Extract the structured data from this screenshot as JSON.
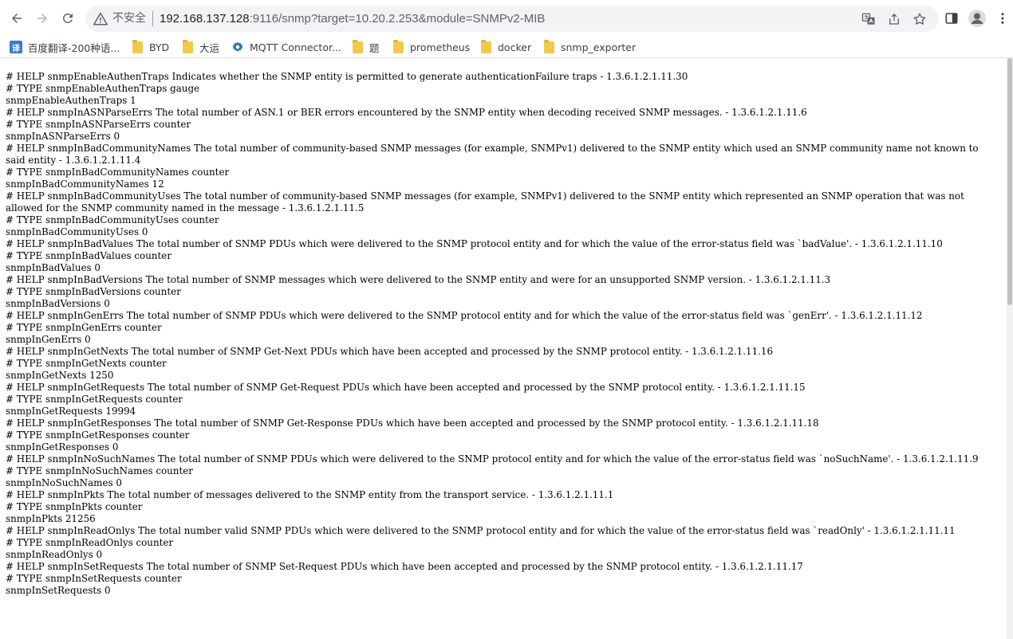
{
  "browser": {
    "insecure_label": "不安全",
    "url_host": "192.168.137.128",
    "url_rest": ":9116/snmp?target=10.20.2.253&module=SNMPv2-MIB"
  },
  "bookmarks": [
    {
      "label": "百度翻译-200种语...",
      "icon": "translate-icon",
      "badge": "译"
    },
    {
      "label": "BYD",
      "icon": "folder-icon"
    },
    {
      "label": "大运",
      "icon": "folder-icon"
    },
    {
      "label": "MQTT Connector...",
      "icon": "gear-icon"
    },
    {
      "label": "题",
      "icon": "folder-icon"
    },
    {
      "label": "prometheus",
      "icon": "folder-icon"
    },
    {
      "label": "docker",
      "icon": "folder-icon"
    },
    {
      "label": "snmp_exporter",
      "icon": "folder-icon"
    }
  ],
  "page_text": "# HELP snmpEnableAuthenTraps Indicates whether the SNMP entity is permitted to generate authenticationFailure traps - 1.3.6.1.2.1.11.30\n# TYPE snmpEnableAuthenTraps gauge\nsnmpEnableAuthenTraps 1\n# HELP snmpInASNParseErrs The total number of ASN.1 or BER errors encountered by the SNMP entity when decoding received SNMP messages. - 1.3.6.1.2.1.11.6\n# TYPE snmpInASNParseErrs counter\nsnmpInASNParseErrs 0\n# HELP snmpInBadCommunityNames The total number of community-based SNMP messages (for example, SNMPv1) delivered to the SNMP entity which used an SNMP community name not known to said entity - 1.3.6.1.2.1.11.4\n# TYPE snmpInBadCommunityNames counter\nsnmpInBadCommunityNames 12\n# HELP snmpInBadCommunityUses The total number of community-based SNMP messages (for example, SNMPv1) delivered to the SNMP entity which represented an SNMP operation that was not allowed for the SNMP community named in the message - 1.3.6.1.2.1.11.5\n# TYPE snmpInBadCommunityUses counter\nsnmpInBadCommunityUses 0\n# HELP snmpInBadValues The total number of SNMP PDUs which were delivered to the SNMP protocol entity and for which the value of the error-status field was `badValue'. - 1.3.6.1.2.1.11.10\n# TYPE snmpInBadValues counter\nsnmpInBadValues 0\n# HELP snmpInBadVersions The total number of SNMP messages which were delivered to the SNMP entity and were for an unsupported SNMP version. - 1.3.6.1.2.1.11.3\n# TYPE snmpInBadVersions counter\nsnmpInBadVersions 0\n# HELP snmpInGenErrs The total number of SNMP PDUs which were delivered to the SNMP protocol entity and for which the value of the error-status field was `genErr'. - 1.3.6.1.2.1.11.12\n# TYPE snmpInGenErrs counter\nsnmpInGenErrs 0\n# HELP snmpInGetNexts The total number of SNMP Get-Next PDUs which have been accepted and processed by the SNMP protocol entity. - 1.3.6.1.2.1.11.16\n# TYPE snmpInGetNexts counter\nsnmpInGetNexts 1250\n# HELP snmpInGetRequests The total number of SNMP Get-Request PDUs which have been accepted and processed by the SNMP protocol entity. - 1.3.6.1.2.1.11.15\n# TYPE snmpInGetRequests counter\nsnmpInGetRequests 19994\n# HELP snmpInGetResponses The total number of SNMP Get-Response PDUs which have been accepted and processed by the SNMP protocol entity. - 1.3.6.1.2.1.11.18\n# TYPE snmpInGetResponses counter\nsnmpInGetResponses 0\n# HELP snmpInNoSuchNames The total number of SNMP PDUs which were delivered to the SNMP protocol entity and for which the value of the error-status field was `noSuchName'. - 1.3.6.1.2.1.11.9\n# TYPE snmpInNoSuchNames counter\nsnmpInNoSuchNames 0\n# HELP snmpInPkts The total number of messages delivered to the SNMP entity from the transport service. - 1.3.6.1.2.1.11.1\n# TYPE snmpInPkts counter\nsnmpInPkts 21256\n# HELP snmpInReadOnlys The total number valid SNMP PDUs which were delivered to the SNMP protocol entity and for which the value of the error-status field was `readOnly' - 1.3.6.1.2.1.11.11\n# TYPE snmpInReadOnlys counter\nsnmpInReadOnlys 0\n# HELP snmpInSetRequests The total number of SNMP Set-Request PDUs which have been accepted and processed by the SNMP protocol entity. - 1.3.6.1.2.1.11.17\n# TYPE snmpInSetRequests counter\nsnmpInSetRequests 0"
}
